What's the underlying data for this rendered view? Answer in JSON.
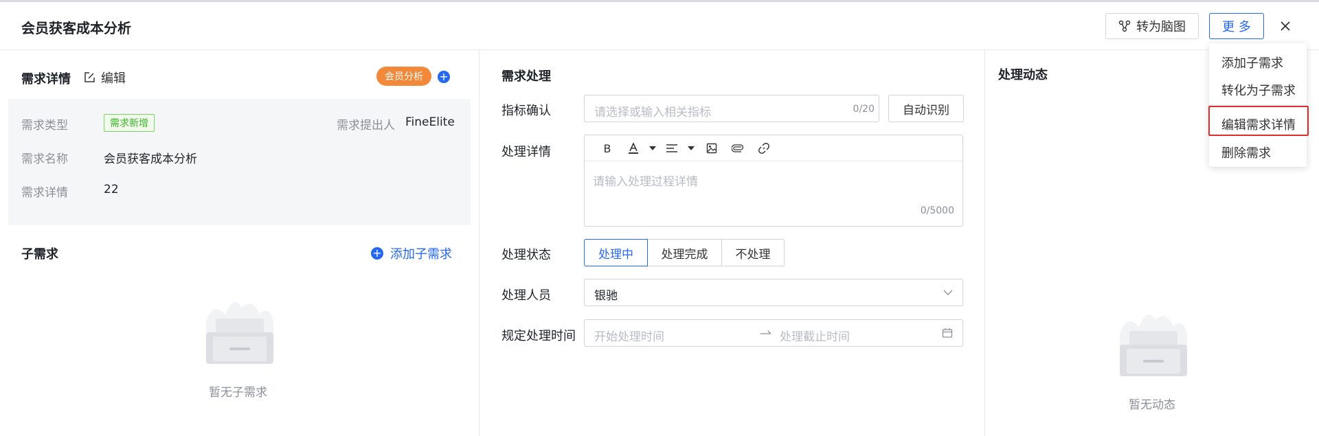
{
  "header": {
    "title": "会员获客成本分析",
    "mindmap_label": "转为脑图",
    "more_label": "更 多"
  },
  "menu": {
    "items": [
      "添加子需求",
      "转化为子需求",
      "编辑需求详情",
      "删除需求"
    ]
  },
  "left": {
    "section_title": "需求详情",
    "edit_label": "编辑",
    "tag": "会员分析",
    "fields": {
      "type_label": "需求类型",
      "type_value": "需求新增",
      "proposer_label": "需求提出人",
      "proposer_value": "FineElite",
      "name_label": "需求名称",
      "name_value": "会员获客成本分析",
      "detail_label": "需求详情",
      "detail_value": "22"
    },
    "child_title": "子需求",
    "add_child_label": "添加子需求",
    "empty_child": "暂无子需求"
  },
  "middle": {
    "section_title": "需求处理",
    "metric_label": "指标确认",
    "metric_placeholder": "请选择或输入相关指标",
    "metric_counter": "0/20",
    "auto_label": "自动识别",
    "detail_label": "处理详情",
    "toolbar_bold": "B",
    "detail_placeholder": "请输入处理过程详情",
    "detail_counter": "0/5000",
    "status_label": "处理状态",
    "status_options": [
      "处理中",
      "处理完成",
      "不处理"
    ],
    "status_selected": 0,
    "assignee_label": "处理人员",
    "assignee_value": "银驰",
    "time_label": "规定处理时间",
    "start_placeholder": "开始处理时间",
    "end_placeholder": "处理截止时间"
  },
  "right": {
    "section_title": "处理动态",
    "empty_text": "暂无动态"
  },
  "colors": {
    "accent": "#2468f2",
    "tag_orange": "#f2893a",
    "tag_green": "#3fb42a",
    "highlight": "#e02b2b"
  }
}
